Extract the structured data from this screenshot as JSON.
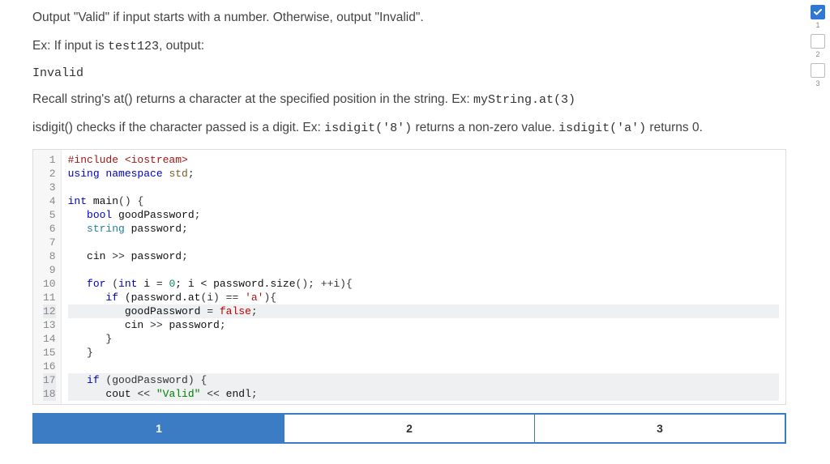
{
  "instructions": {
    "line1_a": "Output \"Valid\" if input starts with a number. Otherwise, output \"Invalid\".",
    "line2_a": "Ex: If input is ",
    "line2_code": "test123",
    "line2_b": ", output:",
    "output_example": "Invalid",
    "line3_a": "Recall string's at() returns a character at the specified position in the string. Ex: ",
    "line3_code": "myString.at(3)",
    "line4_a": "isdigit() checks if the character passed is a digit. Ex: ",
    "line4_code1": "isdigit('8')",
    "line4_b": " returns a non-zero value. ",
    "line4_code2": "isdigit('a')",
    "line4_c": " returns 0."
  },
  "code": {
    "lines": [
      {
        "n": "1",
        "tokens": [
          {
            "t": "#include ",
            "c": "tok-pp"
          },
          {
            "t": "<iostream>",
            "c": "tok-pp"
          }
        ]
      },
      {
        "n": "2",
        "tokens": [
          {
            "t": "using ",
            "c": "tok-kw"
          },
          {
            "t": "namespace ",
            "c": "tok-kw"
          },
          {
            "t": "std",
            "c": "tok-ns"
          },
          {
            "t": ";",
            "c": "tok-op"
          }
        ]
      },
      {
        "n": "3",
        "tokens": []
      },
      {
        "n": "4",
        "tokens": [
          {
            "t": "int ",
            "c": "tok-kw"
          },
          {
            "t": "main",
            "c": "tok-fn"
          },
          {
            "t": "() {",
            "c": "tok-op"
          }
        ]
      },
      {
        "n": "5",
        "tokens": [
          {
            "t": "   ",
            "c": ""
          },
          {
            "t": "bool ",
            "c": "tok-kw"
          },
          {
            "t": "goodPassword",
            "c": "tok-id"
          },
          {
            "t": ";",
            "c": "tok-op"
          }
        ]
      },
      {
        "n": "6",
        "tokens": [
          {
            "t": "   ",
            "c": ""
          },
          {
            "t": "string ",
            "c": "tok-nm"
          },
          {
            "t": "password",
            "c": "tok-id"
          },
          {
            "t": ";",
            "c": "tok-op"
          }
        ]
      },
      {
        "n": "7",
        "tokens": []
      },
      {
        "n": "8",
        "tokens": [
          {
            "t": "   ",
            "c": ""
          },
          {
            "t": "cin ",
            "c": "tok-id"
          },
          {
            "t": ">> ",
            "c": "tok-op"
          },
          {
            "t": "password",
            "c": "tok-id"
          },
          {
            "t": ";",
            "c": "tok-op"
          }
        ]
      },
      {
        "n": "9",
        "tokens": []
      },
      {
        "n": "10",
        "tokens": [
          {
            "t": "   ",
            "c": ""
          },
          {
            "t": "for ",
            "c": "tok-kw"
          },
          {
            "t": "(",
            "c": "tok-op"
          },
          {
            "t": "int ",
            "c": "tok-kw"
          },
          {
            "t": "i ",
            "c": "tok-id"
          },
          {
            "t": "= ",
            "c": "tok-op"
          },
          {
            "t": "0",
            "c": "tok-num"
          },
          {
            "t": "; i < password.",
            "c": "tok-id"
          },
          {
            "t": "size",
            "c": "tok-fn"
          },
          {
            "t": "(); ++i){",
            "c": "tok-op"
          }
        ]
      },
      {
        "n": "11",
        "tokens": [
          {
            "t": "      ",
            "c": ""
          },
          {
            "t": "if ",
            "c": "tok-kw"
          },
          {
            "t": "(password.",
            "c": "tok-id"
          },
          {
            "t": "at",
            "c": "tok-fn"
          },
          {
            "t": "(i) == ",
            "c": "tok-op"
          },
          {
            "t": "'a'",
            "c": "tok-char"
          },
          {
            "t": "){",
            "c": "tok-op"
          }
        ]
      },
      {
        "n": "12",
        "hl": true,
        "tokens": [
          {
            "t": "         ",
            "c": ""
          },
          {
            "t": "goodPassword ",
            "c": "tok-id"
          },
          {
            "t": "= ",
            "c": "tok-op"
          },
          {
            "t": "false",
            "c": "tok-bool"
          },
          {
            "t": ";",
            "c": "tok-op"
          }
        ]
      },
      {
        "n": "13",
        "tokens": [
          {
            "t": "         ",
            "c": ""
          },
          {
            "t": "cin ",
            "c": "tok-id"
          },
          {
            "t": ">> ",
            "c": "tok-op"
          },
          {
            "t": "password",
            "c": "tok-id"
          },
          {
            "t": ";",
            "c": "tok-op"
          }
        ]
      },
      {
        "n": "14",
        "tokens": [
          {
            "t": "      }",
            "c": "tok-op"
          }
        ]
      },
      {
        "n": "15",
        "tokens": [
          {
            "t": "   }",
            "c": "tok-op"
          }
        ]
      },
      {
        "n": "16",
        "tokens": []
      },
      {
        "n": "17",
        "hl": true,
        "tokens": [
          {
            "t": "   ",
            "c": ""
          },
          {
            "t": "if ",
            "c": "tok-kw"
          },
          {
            "t": "(goodPassword) {",
            "c": "tok-op"
          }
        ]
      },
      {
        "n": "18",
        "hl": true,
        "tokens": [
          {
            "t": "      ",
            "c": ""
          },
          {
            "t": "cout ",
            "c": "tok-id"
          },
          {
            "t": "<< ",
            "c": "tok-op"
          },
          {
            "t": "\"Valid\"",
            "c": "tok-str"
          },
          {
            "t": " << ",
            "c": "tok-op"
          },
          {
            "t": "endl",
            "c": "tok-id"
          },
          {
            "t": ";",
            "c": "tok-op"
          }
        ]
      }
    ]
  },
  "pager": {
    "items": [
      {
        "label": "1",
        "active": true
      },
      {
        "label": "2",
        "active": false
      },
      {
        "label": "3",
        "active": false
      }
    ]
  },
  "right_rail": {
    "items": [
      {
        "num": "1",
        "checked": true
      },
      {
        "num": "2",
        "checked": false
      },
      {
        "num": "3",
        "checked": false
      }
    ]
  }
}
